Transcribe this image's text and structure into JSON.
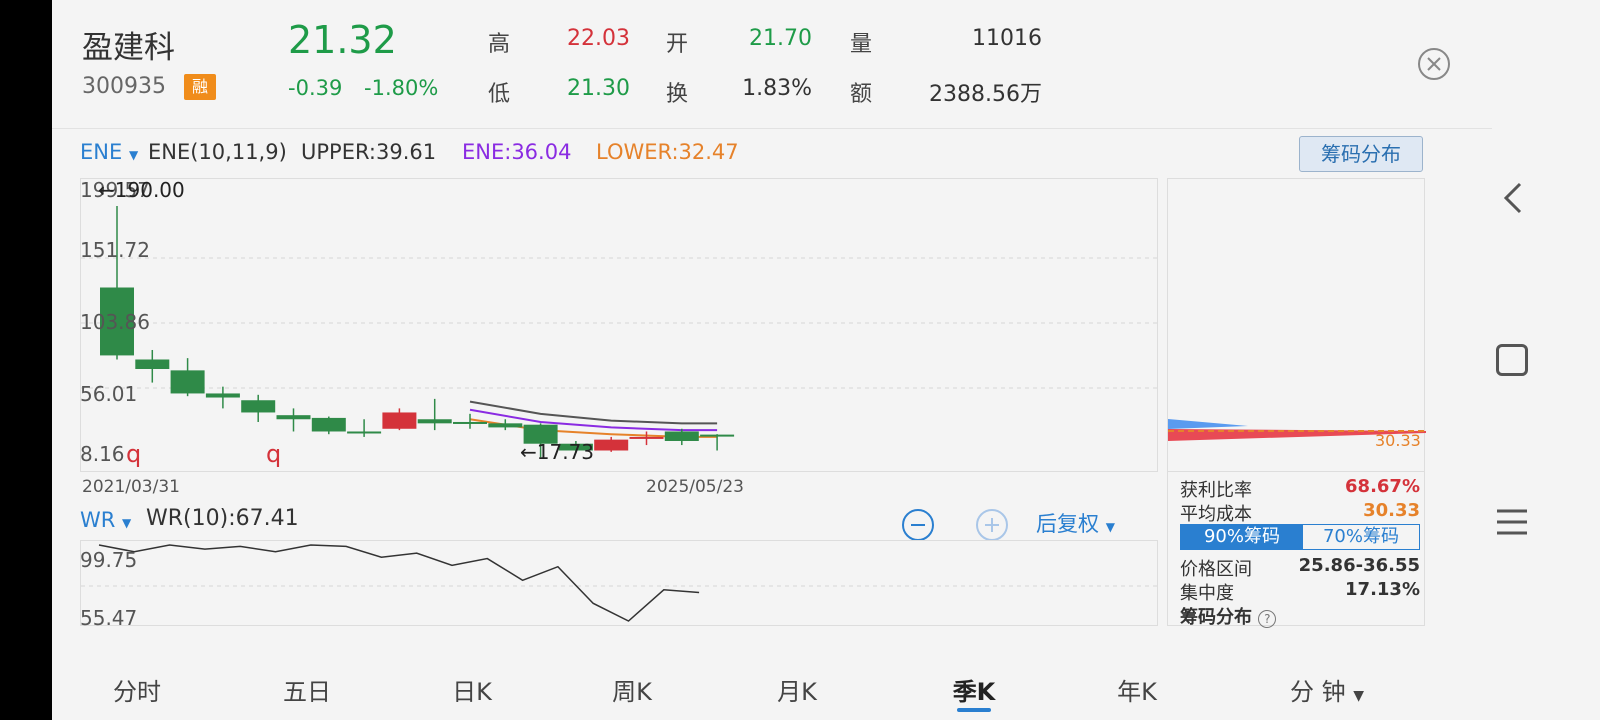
{
  "header": {
    "name": "盈建科",
    "code": "300935",
    "margin_badge": "融",
    "price": "21.32",
    "change": "-0.39",
    "change_pct": "-1.80%",
    "quotes": [
      {
        "label": "高",
        "value": "22.03"
      },
      {
        "label": "开",
        "value": "21.70"
      },
      {
        "label": "量",
        "value": "11016"
      },
      {
        "label": "低",
        "value": "21.30"
      },
      {
        "label": "换",
        "value": "1.83%"
      },
      {
        "label": "额",
        "value": "2388.56万"
      }
    ]
  },
  "indicator": {
    "selector": "ENE",
    "params": "ENE(10,11,9)",
    "upper": "UPPER:39.61",
    "ene": "ENE:36.04",
    "lower": "LOWER:32.47",
    "chip_button": "筹码分布"
  },
  "kline": {
    "y_labels": [
      "199.57",
      "151.72",
      "103.86",
      "56.01",
      "8.16"
    ],
    "max_label": "190.00",
    "min_label": "17.73",
    "markers": [
      "q",
      "q"
    ],
    "start_date": "2021/03/31",
    "end_date": "2025/05/23",
    "candles": [
      {
        "open": 130,
        "close": 80,
        "high": 190,
        "low": 77
      },
      {
        "open": 77,
        "close": 70,
        "high": 84,
        "low": 60
      },
      {
        "open": 69,
        "close": 52,
        "high": 78,
        "low": 50
      },
      {
        "open": 52,
        "close": 49,
        "high": 57,
        "low": 41
      },
      {
        "open": 47,
        "close": 38,
        "high": 51,
        "low": 31
      },
      {
        "open": 36,
        "close": 33,
        "high": 41,
        "low": 24
      },
      {
        "open": 34,
        "close": 24,
        "high": 35,
        "low": 22
      },
      {
        "open": 24,
        "close": 23,
        "high": 33,
        "low": 20
      },
      {
        "open": 26,
        "close": 38,
        "high": 41,
        "low": 25
      },
      {
        "open": 33,
        "close": 30,
        "high": 48,
        "low": 25
      },
      {
        "open": 31,
        "close": 30,
        "high": 37,
        "low": 26
      },
      {
        "open": 30,
        "close": 27,
        "high": 33,
        "low": 25
      },
      {
        "open": 29,
        "close": 15,
        "high": 30,
        "low": 5
      },
      {
        "open": 15,
        "close": 10,
        "high": 17,
        "low": 8
      },
      {
        "open": 10,
        "close": 18,
        "high": 20,
        "low": 9
      },
      {
        "open": 19,
        "close": 20,
        "high": 24,
        "low": 14
      },
      {
        "open": 24,
        "close": 17,
        "high": 26,
        "low": 14
      },
      {
        "open": 21.7,
        "close": 21.32,
        "high": 22.03,
        "low": 10
      }
    ],
    "upper_line": [
      {
        "i": 10,
        "v": 46
      },
      {
        "i": 12,
        "v": 37
      },
      {
        "i": 14,
        "v": 32
      },
      {
        "i": 16,
        "v": 30
      },
      {
        "i": 17,
        "v": 30
      }
    ],
    "mid_line": [
      {
        "i": 10,
        "v": 40
      },
      {
        "i": 12,
        "v": 31
      },
      {
        "i": 14,
        "v": 27
      },
      {
        "i": 16,
        "v": 25
      },
      {
        "i": 17,
        "v": 25
      }
    ],
    "lower_line": [
      {
        "i": 10,
        "v": 33
      },
      {
        "i": 12,
        "v": 25
      },
      {
        "i": 14,
        "v": 22
      },
      {
        "i": 16,
        "v": 20
      },
      {
        "i": 17,
        "v": 20
      }
    ]
  },
  "wr": {
    "selector": "WR",
    "value": "WR(10):67.41",
    "right_label": "后复权",
    "y_labels": [
      "99.75",
      "55.47"
    ],
    "points": [
      100,
      95,
      100,
      97,
      99,
      95,
      100,
      99,
      91,
      94,
      85,
      90,
      74,
      84,
      57,
      44,
      67,
      65
    ]
  },
  "chips": {
    "price_label": "30.33",
    "profit_ratio_label": "获利比率",
    "profit_ratio": "68.67%",
    "avg_cost_label": "平均成本",
    "avg_cost": "30.33",
    "tab90": "90%筹码",
    "tab70": "70%筹码",
    "range_label": "价格区间",
    "range": "25.86-36.55",
    "concentration_label": "集中度",
    "concentration": "17.13%",
    "footer": "筹码分布"
  },
  "periods": [
    "分时",
    "五日",
    "日K",
    "周K",
    "月K",
    "季K",
    "年K",
    "分 钟"
  ],
  "colors": {
    "up": "#d4323a",
    "down": "#2f8a48",
    "accent": "#2a7fd0",
    "upper": "#555555",
    "ene": "#8a2be2",
    "lower": "#e6822a"
  }
}
